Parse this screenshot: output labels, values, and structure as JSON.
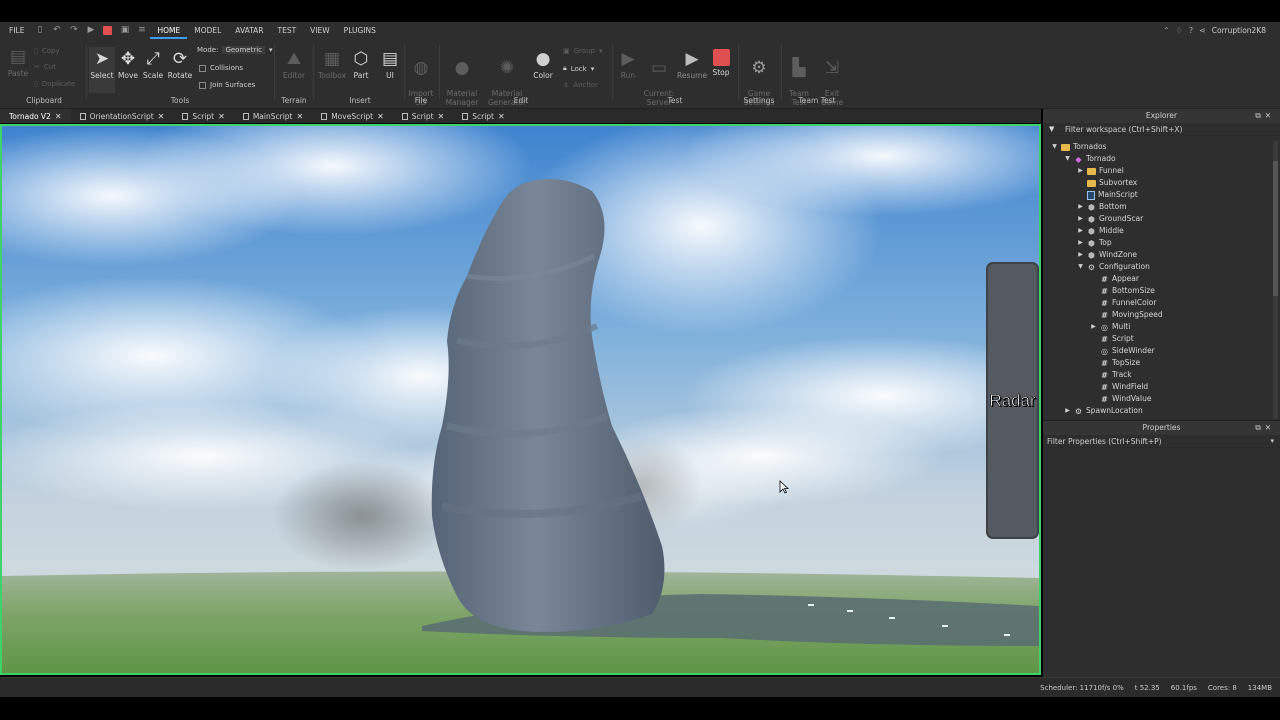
{
  "menubar": {
    "file": "FILE",
    "tabs": [
      "HOME",
      "MODEL",
      "AVATAR",
      "TEST",
      "VIEW",
      "PLUGINS"
    ],
    "user": "Corruption2K8"
  },
  "ribbon": {
    "clipboard": {
      "paste": "Paste",
      "copy": "Copy",
      "cut": "Cut",
      "duplicate": "Duplicate",
      "label": "Clipboard"
    },
    "tools": {
      "select": "Select",
      "move": "Move",
      "scale": "Scale",
      "rotate": "Rotate",
      "mode_label": "Mode:",
      "mode_value": "Geometric",
      "collisions": "Collisions",
      "join_surfaces": "Join Surfaces",
      "label": "Tools"
    },
    "terrain": {
      "editor": "Editor",
      "label": "Terrain"
    },
    "insert": {
      "toolbox": "Toolbox",
      "part": "Part",
      "ui": "UI",
      "label": "Insert"
    },
    "file": {
      "import_3d": "Import\n3D",
      "label": "File"
    },
    "edit": {
      "material_manager": "Material\nManager",
      "material_generator": "Material\nGenerator",
      "color": "Color",
      "group": "Group",
      "lock": "Lock",
      "anchor": "Anchor",
      "label": "Edit"
    },
    "test": {
      "run": "Run",
      "current_server": "Current:\nServer",
      "resume": "Resume",
      "stop": "Stop",
      "label": "Test"
    },
    "settings": {
      "game_settings": "Game\nSettings",
      "label": "Settings"
    },
    "team_test": {
      "team_test": "Team\nTest",
      "exit_game": "Exit\nGame",
      "label": "Team Test"
    }
  },
  "tabs": [
    {
      "label": "Tornado V2",
      "active": true
    },
    {
      "label": "OrientationScript"
    },
    {
      "label": "Script"
    },
    {
      "label": "MainScript"
    },
    {
      "label": "MoveScript"
    },
    {
      "label": "Script"
    },
    {
      "label": "Script"
    }
  ],
  "viewport": {
    "radar_label": "Radar"
  },
  "explorer": {
    "title": "Explorer",
    "filter_placeholder": "Filter workspace (Ctrl+Shift+X)",
    "nodes": [
      {
        "label": "Tornados",
        "icon": "folder-icon",
        "depth": 0,
        "arrow": "down"
      },
      {
        "label": "Tornado",
        "icon": "model-icon",
        "depth": 1,
        "arrow": "down"
      },
      {
        "label": "Funnel",
        "icon": "folder-icon",
        "depth": 2,
        "arrow": "right"
      },
      {
        "label": "Subvortex",
        "icon": "folder-icon",
        "depth": 2,
        "arrow": ""
      },
      {
        "label": "MainScript",
        "icon": "script-icon",
        "depth": 2,
        "arrow": ""
      },
      {
        "label": "Bottom",
        "icon": "part-icon",
        "depth": 2,
        "arrow": "right"
      },
      {
        "label": "GroundScar",
        "icon": "part-icon",
        "depth": 2,
        "arrow": "right"
      },
      {
        "label": "Middle",
        "icon": "part-icon",
        "depth": 2,
        "arrow": "right"
      },
      {
        "label": "Top",
        "icon": "part-icon",
        "depth": 2,
        "arrow": "right"
      },
      {
        "label": "WindZone",
        "icon": "part-icon",
        "depth": 2,
        "arrow": "right"
      },
      {
        "label": "Configuration",
        "icon": "gear-icon",
        "depth": 2,
        "arrow": "down"
      },
      {
        "label": "Appear",
        "icon": "number-icon",
        "depth": 3,
        "arrow": ""
      },
      {
        "label": "BottomSize",
        "icon": "number-icon",
        "depth": 3,
        "arrow": ""
      },
      {
        "label": "FunnelColor",
        "icon": "number-icon",
        "depth": 3,
        "arrow": ""
      },
      {
        "label": "MovingSpeed",
        "icon": "number-icon",
        "depth": 3,
        "arrow": ""
      },
      {
        "label": "Multi",
        "icon": "value-icon",
        "depth": 3,
        "arrow": "right"
      },
      {
        "label": "Script",
        "icon": "number-icon",
        "depth": 3,
        "arrow": ""
      },
      {
        "label": "SideWinder",
        "icon": "value-icon",
        "depth": 3,
        "arrow": ""
      },
      {
        "label": "TopSize",
        "icon": "number-icon",
        "depth": 3,
        "arrow": ""
      },
      {
        "label": "Track",
        "icon": "number-icon",
        "depth": 3,
        "arrow": ""
      },
      {
        "label": "WindField",
        "icon": "number-icon",
        "depth": 3,
        "arrow": ""
      },
      {
        "label": "WindValue",
        "icon": "number-icon",
        "depth": 3,
        "arrow": ""
      },
      {
        "label": "SpawnLocation",
        "icon": "spawn-icon",
        "depth": 1,
        "arrow": "right"
      }
    ]
  },
  "properties": {
    "title": "Properties",
    "filter_placeholder": "Filter Properties (Ctrl+Shift+P)"
  },
  "status": {
    "scheduler": "Scheduler: 11710f/s 0%",
    "time": "t 52.35",
    "fps": "60.1fps",
    "cores": "Cores: 8",
    "memory": "134MB"
  },
  "colors": {
    "accent": "#3a9bf0",
    "viewport_border": "#3fd16a",
    "stop": "#e05050"
  }
}
